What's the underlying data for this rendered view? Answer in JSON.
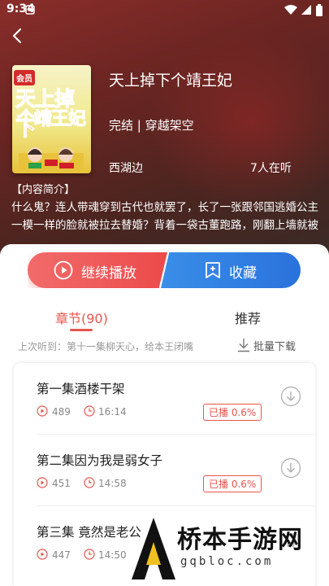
{
  "status": {
    "time": "9:34"
  },
  "book": {
    "cover_badge": "会员",
    "cover_title_line1": "天上掉下",
    "cover_title_line2": "个靖王妃",
    "title": "天上掉下个靖王妃",
    "meta": "完结 | 穿越架空",
    "author": "西湖边",
    "listeners": "7人在听"
  },
  "intro": {
    "heading": "【内容简介】",
    "text": "什么鬼？连人带魂穿到古代也就罢了，长了一张跟邻国逃婚公主一模一样的脸就被拉去替婚？背着一袋古董跑路，刚翻上墙就被消失…"
  },
  "actions": {
    "play_label": "继续播放",
    "fav_label": "收藏"
  },
  "tabs": {
    "chapters_label": "章节(90)",
    "recommend_label": "推荐"
  },
  "last_played": "上次听到：第十一集柳天心，给本王闭嘴",
  "batch_download": "批量下载",
  "episodes": [
    {
      "title": "第一集酒楼干架",
      "plays": "489",
      "duration": "16:14",
      "progress": "已播 0.6%"
    },
    {
      "title": "第二集因为我是弱女子",
      "plays": "451",
      "duration": "14:58",
      "progress": "已播 0.6%"
    },
    {
      "title": "第三集 竟然是老公",
      "plays": "447",
      "duration": "14:50",
      "progress": ""
    }
  ],
  "watermark": {
    "text": "桥本手游网",
    "url": "gqbloc.com"
  },
  "colors": {
    "accent_red": "#e8554d",
    "accent_blue": "#2a72dc"
  }
}
